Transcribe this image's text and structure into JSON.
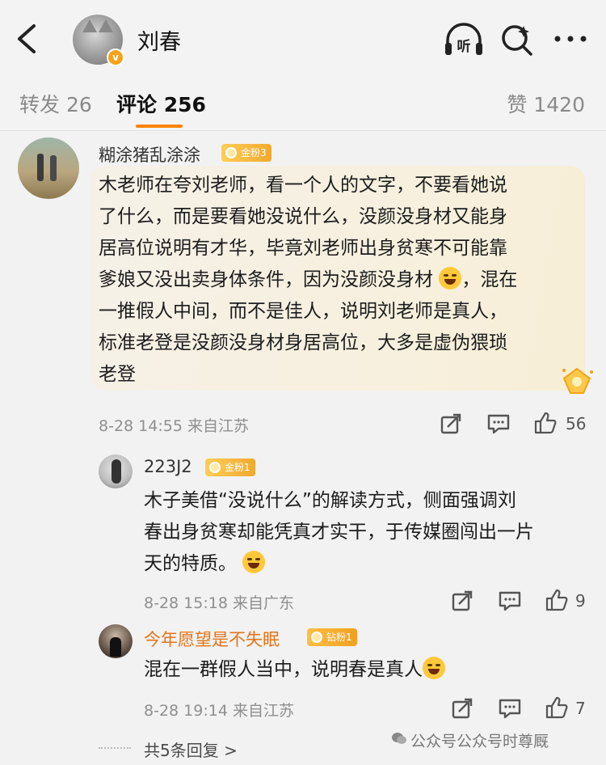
{
  "header": {
    "title": "刘春",
    "verified_badge": "v",
    "icons": [
      "back-arrow-icon",
      "listen-icon",
      "search-icon",
      "more-icon"
    ],
    "listen_label": "听"
  },
  "tabs": {
    "repost": "转发 26",
    "comments": "评论 256",
    "likes": "赞 1420"
  },
  "accent_color": "#ff8200",
  "comments": [
    {
      "username": "糊涂猪乱涂涂",
      "badge": "金粉3",
      "lines": [
        "木老师在夸刘老师，看一个人的文字，不要看她说",
        "了什么，而是要看她没说什么，没颜没身材又能身",
        "居高位说明有才华，毕竟刘老师出身贫寒不可能靠",
        "爹娘又没出卖身体条件，因为没颜没身材",
        "，混在",
        "一推假人中间，而不是佳人，说明刘老师是真人，",
        "标准老登是没颜没身材身居高位，大多是虚伪猥琐",
        "老登"
      ],
      "meta": "8-28 14:55  来自江苏",
      "likes": "56"
    }
  ],
  "replies": [
    {
      "username": "223J2",
      "badge": "金粉1",
      "lines": [
        "木子美借“没说什么”的解读方式，侧面强调刘",
        "春出身贫寒却能凭真才实干，于传媒圈闯出一片",
        "天的特质。"
      ],
      "meta": "8-28 15:18  来自广东",
      "likes": "9"
    },
    {
      "username": "今年愿望是不失眠",
      "badge": "钻粉1",
      "lines": [
        "混在一群假人当中，说明春是真人"
      ],
      "meta": "8-28 19:14  来自江苏",
      "likes": "7"
    }
  ],
  "more_replies": "共5条回复 >",
  "watermark": "公众号公众号时尊厩"
}
